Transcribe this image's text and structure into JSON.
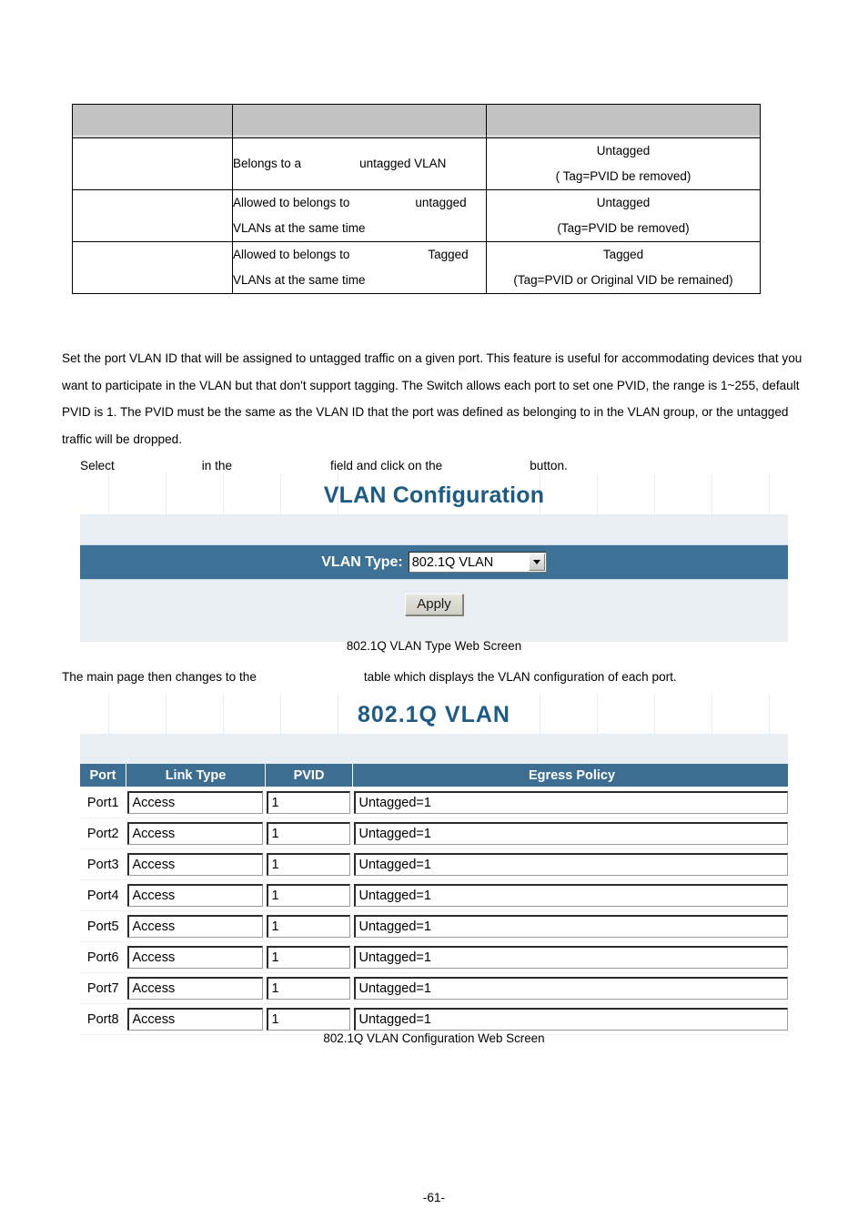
{
  "attribute_table": {
    "header": [
      "",
      "",
      ""
    ],
    "rows": [
      {
        "col1": "",
        "col2_lines": [
          "Belongs to a",
          "untagged VLAN"
        ],
        "col2_layout": "single-line-with-gap",
        "col3_lines": [
          "Untagged",
          "( Tag=PVID be removed)"
        ]
      },
      {
        "col1": "",
        "col2_lines": [
          "Allowed to belongs to",
          "untagged",
          "VLANs at the same time"
        ],
        "col2_layout": "two-line-with-gap",
        "col3_lines": [
          "Untagged",
          "(Tag=PVID be removed)"
        ]
      },
      {
        "col1": "",
        "col2_lines": [
          "Allowed to belongs to",
          "Tagged",
          "VLANs at the same time"
        ],
        "col2_layout": "two-line-with-gap",
        "col3_lines": [
          "Tagged",
          "(Tag=PVID or Original VID be remained)"
        ]
      }
    ]
  },
  "body": {
    "paragraph_pvid": "Set the port VLAN ID that will be assigned to untagged traffic on a given port. This feature is useful for accommodating devices that you want to participate in the VLAN but that don't support tagging. The Switch allows each port to set one PVID, the range is 1~255, default PVID is 1. The PVID must be the same as the VLAN ID that the port was defined as belonging to in the VLAN group, or the untagged traffic will be dropped.",
    "select_instruction": {
      "part1": "Select",
      "part2": "in the",
      "part3": "field and click on the",
      "part4": "button."
    },
    "mainpage_instruction": {
      "part1": "The main page then changes to the",
      "part2": "table which displays the VLAN configuration of each port."
    }
  },
  "vlan_config_screen": {
    "title": "VLAN Configuration",
    "vlan_type_label": "VLAN Type:",
    "vlan_type_value": "802.1Q VLAN",
    "apply_label": "Apply",
    "caption": "802.1Q VLAN Type Web Screen",
    "accent_blue": "#3d7296",
    "panel_light": "#e9eef5",
    "title_color": "#1d5b84"
  },
  "vlan_table_screen": {
    "title": "802.1Q   VLAN",
    "columns": [
      "Port",
      "Link Type",
      "PVID",
      "Egress Policy"
    ],
    "rows": [
      {
        "port": "Port1",
        "link_type": "Access",
        "pvid": "1",
        "egress_policy": "Untagged=1"
      },
      {
        "port": "Port2",
        "link_type": "Access",
        "pvid": "1",
        "egress_policy": "Untagged=1"
      },
      {
        "port": "Port3",
        "link_type": "Access",
        "pvid": "1",
        "egress_policy": "Untagged=1"
      },
      {
        "port": "Port4",
        "link_type": "Access",
        "pvid": "1",
        "egress_policy": "Untagged=1"
      },
      {
        "port": "Port5",
        "link_type": "Access",
        "pvid": "1",
        "egress_policy": "Untagged=1"
      },
      {
        "port": "Port6",
        "link_type": "Access",
        "pvid": "1",
        "egress_policy": "Untagged=1"
      },
      {
        "port": "Port7",
        "link_type": "Access",
        "pvid": "1",
        "egress_policy": "Untagged=1"
      },
      {
        "port": "Port8",
        "link_type": "Access",
        "pvid": "1",
        "egress_policy": "Untagged=1"
      }
    ],
    "caption": "802.1Q VLAN Configuration Web Screen",
    "header_blue": "#3d6e92"
  },
  "page_number": "-61-"
}
